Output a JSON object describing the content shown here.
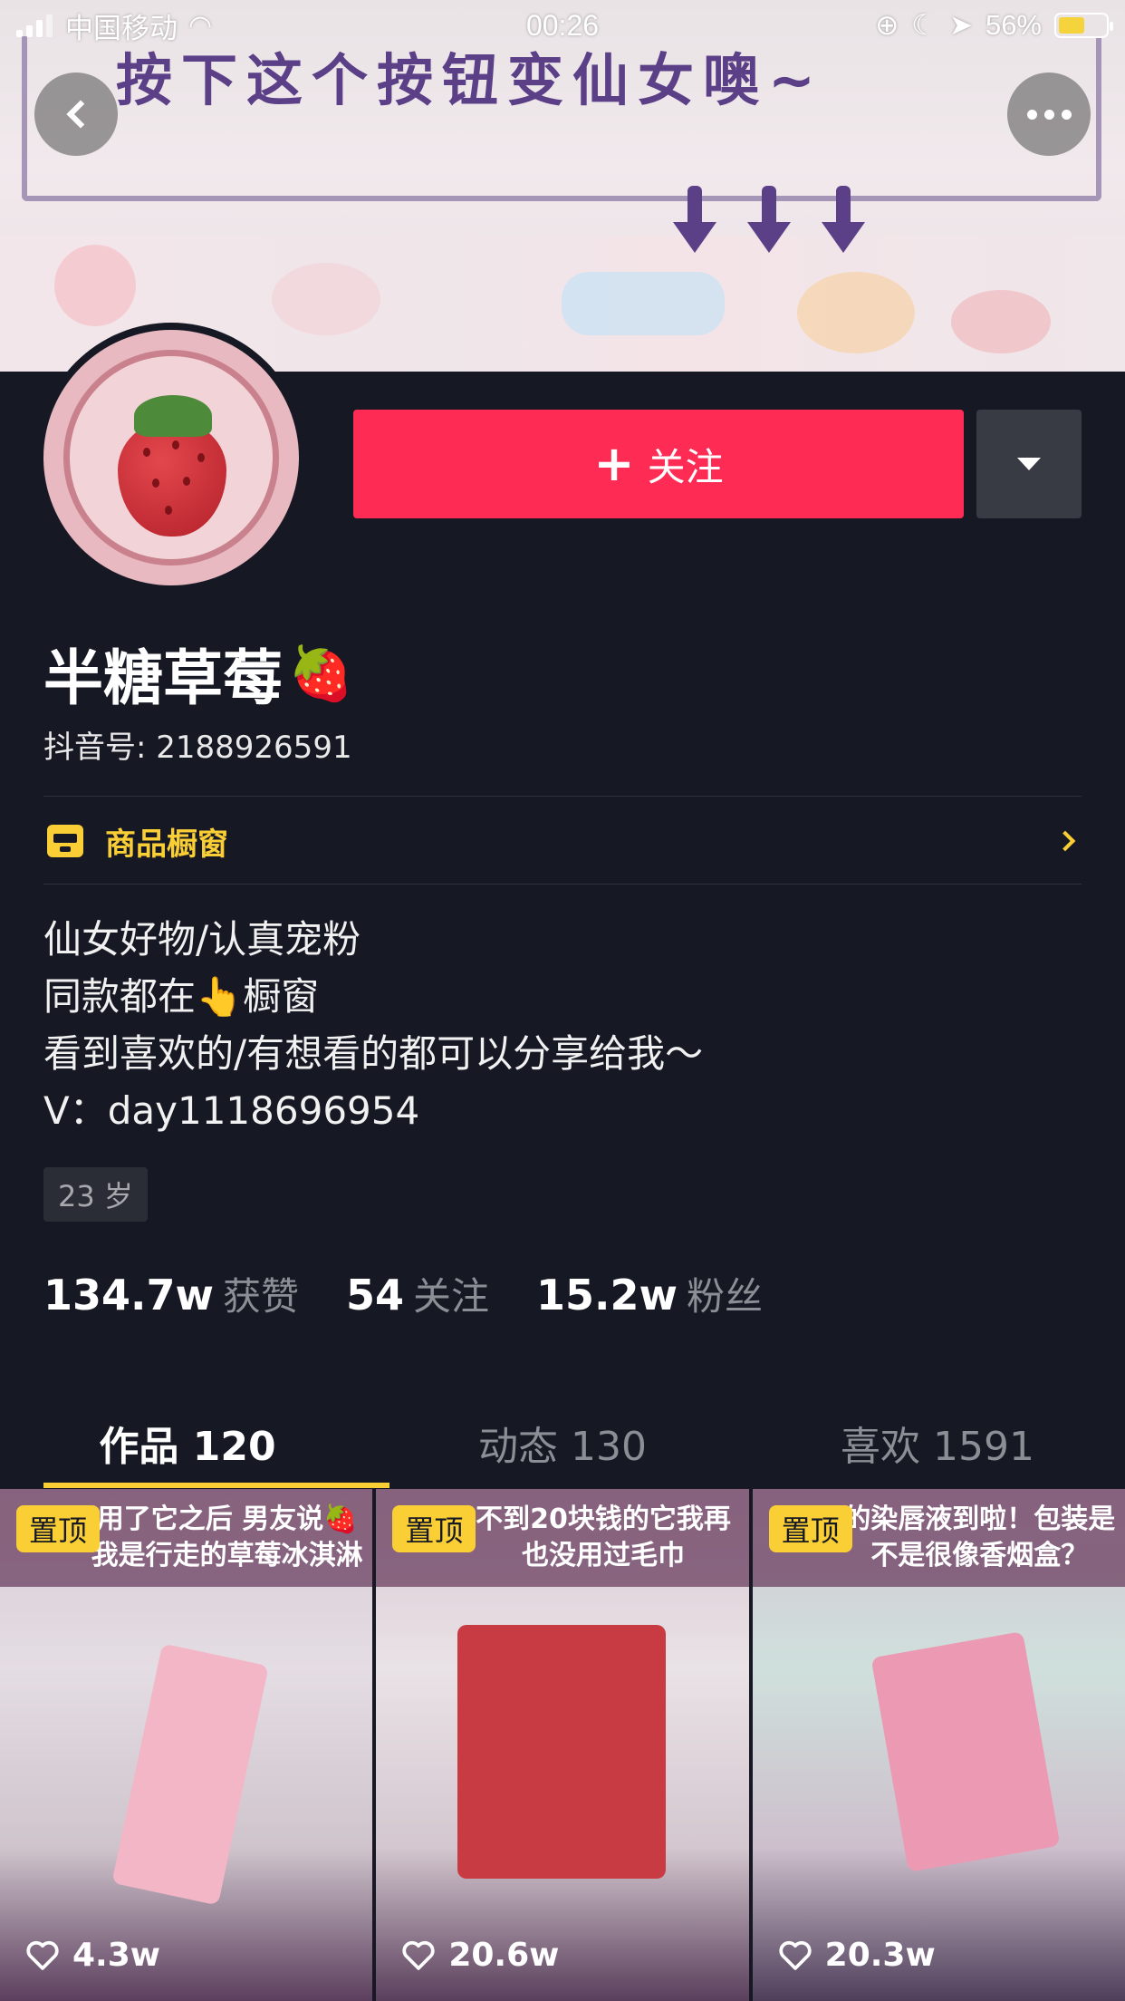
{
  "status_bar": {
    "carrier": "中国移动",
    "time": "00:26",
    "battery": "56%"
  },
  "banner": {
    "headline": "按下这个按钮变仙女噢~"
  },
  "profile": {
    "follow_label": "关注",
    "name": "半糖草莓",
    "name_emoji": "🍓",
    "douyin_id": "抖音号: 2188926591",
    "shop_label": "商品橱窗",
    "bio": [
      "仙女好物/认真宠粉",
      "同款都在👆橱窗",
      "看到喜欢的/有想看的都可以分享给我～",
      "V：day1118696954"
    ],
    "age": "23 岁",
    "stats": [
      {
        "num": "134.7w",
        "label": "获赞"
      },
      {
        "num": "54",
        "label": "关注"
      },
      {
        "num": "15.2w",
        "label": "粉丝"
      }
    ]
  },
  "tabs": [
    {
      "label": "作品 120",
      "active": true
    },
    {
      "label": "动态 130",
      "active": false
    },
    {
      "label": "喜欢 1591",
      "active": false
    }
  ],
  "videos": [
    {
      "pin": "置顶",
      "caption": "用了它之后 男友说🍓我是行走的草莓冰淇淋",
      "likes": "4.3w"
    },
    {
      "pin": "置顶",
      "caption": "不到20块钱的它我再也没用过毛巾",
      "likes": "20.6w"
    },
    {
      "pin": "置顶",
      "caption": "的染唇液到啦！包装是不是很像香烟盒？",
      "likes": "20.3w"
    }
  ],
  "colors": {
    "background": "#161823",
    "follow_button": "#fe2c55",
    "accent_yellow": "#facf36"
  }
}
